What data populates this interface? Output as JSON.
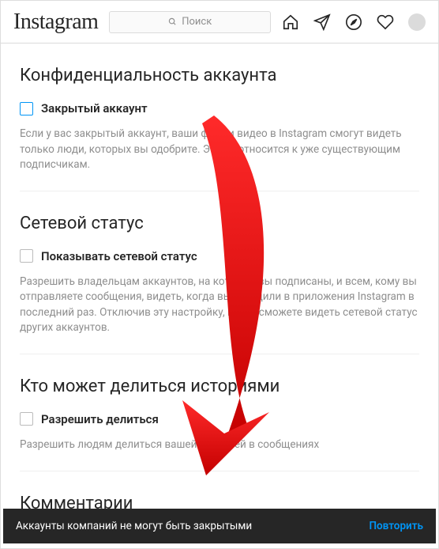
{
  "header": {
    "logo": "Instagram",
    "search_placeholder": "Поиск"
  },
  "sections": {
    "privacy": {
      "title": "Конфиденциальность аккаунта",
      "checkbox_label": "Закрытый аккаунт",
      "desc": "Если у вас закрытый аккаунт, ваши фото и видео в Instagram смогут видеть только люди, которых вы одобрите. Это не относится к уже существующим подписчикам."
    },
    "activity": {
      "title": "Сетевой статус",
      "checkbox_label": "Показывать сетевой статус",
      "desc": "Разрешить владельцам аккаунтов, на которые вы подписаны, и всем, кому вы отправляете сообщения, видеть, когда вы заходили в приложения Instagram в последний раз. Отключив эту настройку, вы не сможете видеть сетевой статус других аккаунтов."
    },
    "story": {
      "title": "Кто может делиться историями",
      "checkbox_label": "Разрешить делиться",
      "desc": "Разрешить людям делиться вашей историей в сообщениях"
    },
    "comments": {
      "title": "Комментарии"
    }
  },
  "toast": {
    "message": "Аккаунты компаний не могут быть закрытыми",
    "action": "Повторить"
  }
}
